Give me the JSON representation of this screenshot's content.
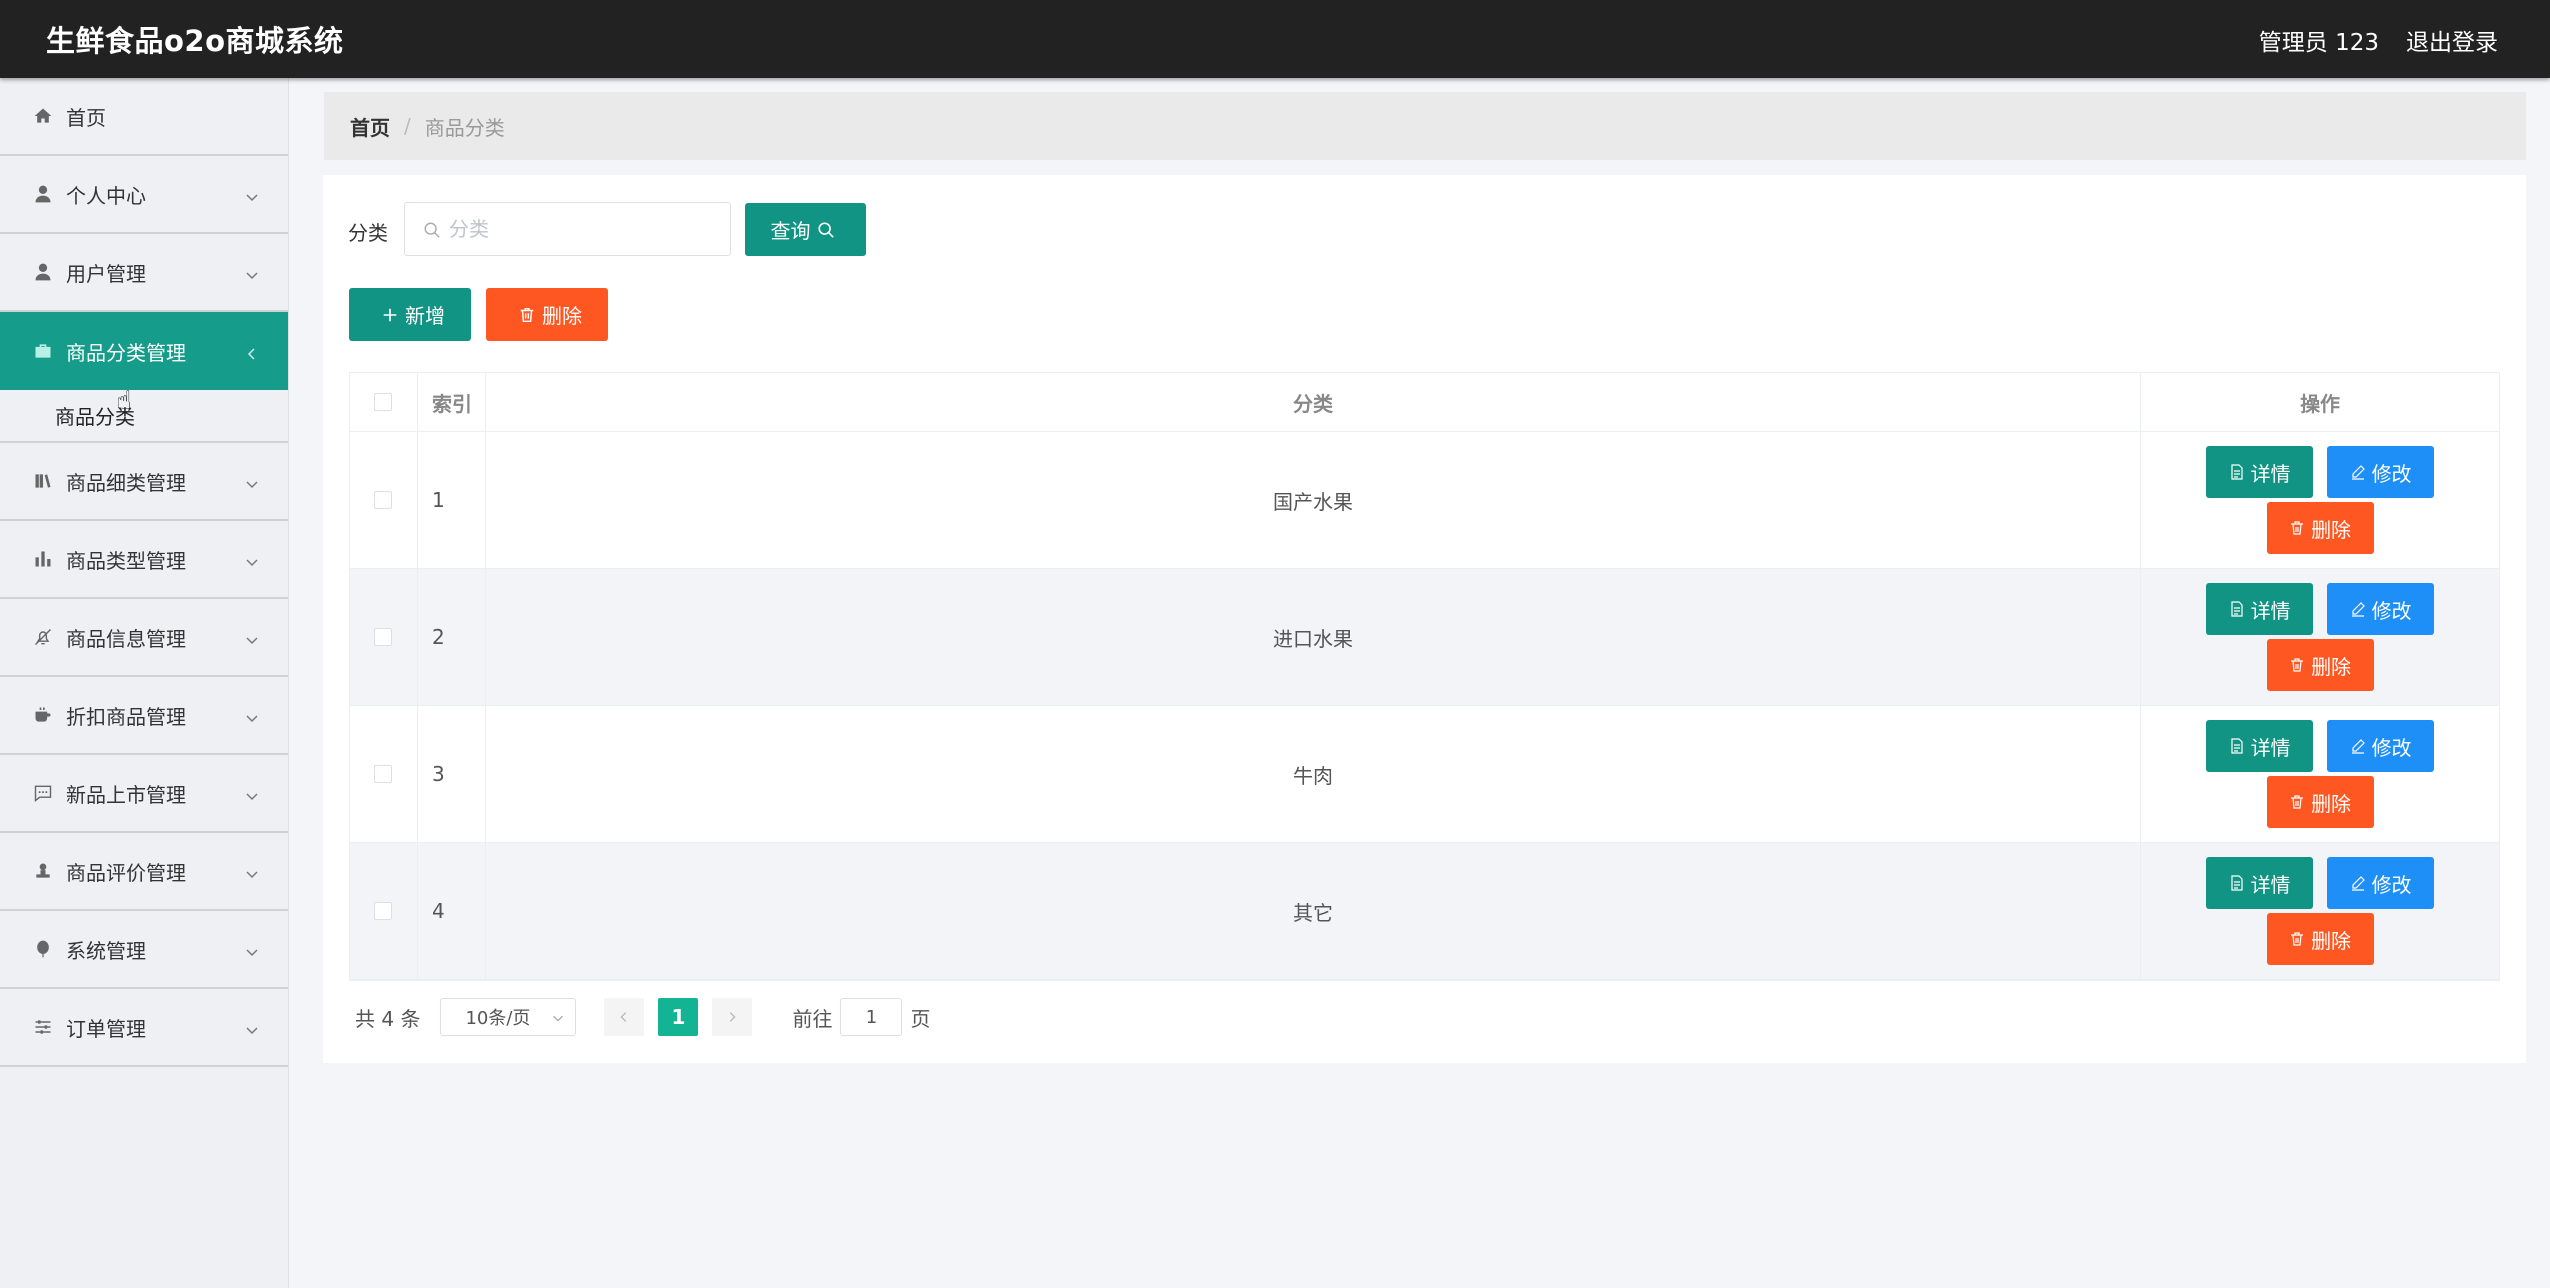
{
  "header": {
    "title": "生鲜食品o2o商城系统",
    "user": "管理员 123",
    "logout": "退出登录"
  },
  "sidebar": {
    "items": [
      {
        "label": "首页",
        "icon": "home-icon"
      },
      {
        "label": "个人中心",
        "icon": "person-icon"
      },
      {
        "label": "用户管理",
        "icon": "person-icon"
      },
      {
        "label": "商品分类管理",
        "icon": "briefcase-icon"
      },
      {
        "label": "商品细类管理",
        "icon": "bookshelf-icon"
      },
      {
        "label": "商品类型管理",
        "icon": "bar-chart-icon"
      },
      {
        "label": "商品信息管理",
        "icon": "bell-off-icon"
      },
      {
        "label": "折扣商品管理",
        "icon": "coffee-icon"
      },
      {
        "label": "新品上市管理",
        "icon": "chat-icon"
      },
      {
        "label": "商品评价管理",
        "icon": "stamp-icon"
      },
      {
        "label": "系统管理",
        "icon": "balloon-icon"
      },
      {
        "label": "订单管理",
        "icon": "sliders-icon"
      }
    ],
    "submenu": "商品分类"
  },
  "breadcrumb": {
    "home": "首页",
    "separator": "/",
    "current": "商品分类"
  },
  "search": {
    "label": "分类",
    "placeholder": "分类",
    "query_button": "查询"
  },
  "actions": {
    "add": "新增",
    "delete": "删除"
  },
  "table": {
    "headers": {
      "index": "索引",
      "category": "分类",
      "operations": "操作"
    },
    "rows": [
      {
        "index": "1",
        "category": "国产水果"
      },
      {
        "index": "2",
        "category": "进口水果"
      },
      {
        "index": "3",
        "category": "牛肉"
      },
      {
        "index": "4",
        "category": "其它"
      }
    ],
    "op_labels": {
      "detail": "详情",
      "edit": "修改",
      "delete": "删除"
    }
  },
  "pagination": {
    "total": "共 4 条",
    "page_size": "10条/页",
    "current_page": "1",
    "goto_label": "前往",
    "goto_value": "1",
    "page_suffix": "页"
  },
  "colors": {
    "header_bg": "#222222",
    "primary": "#119484",
    "danger": "#fe5722",
    "edit": "#1e8ff7",
    "active_menu": "#159c8a"
  }
}
